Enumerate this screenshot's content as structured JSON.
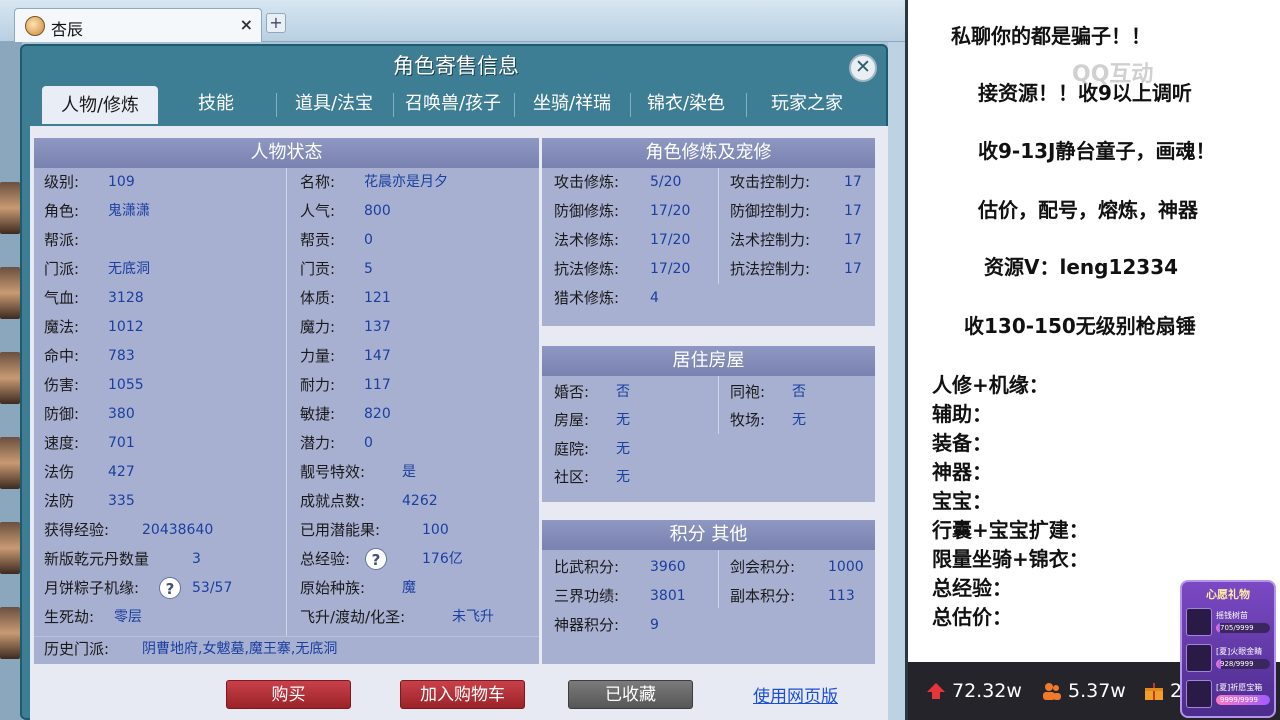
{
  "browser": {
    "tab_title": "杏辰",
    "tab_close": "×",
    "new_tab": "+"
  },
  "dialog": {
    "title": "角色寄售信息",
    "close": "✕",
    "tabs": [
      "人物/修炼",
      "技能",
      "道具/法宝",
      "召唤兽/孩子",
      "坐骑/祥瑞",
      "锦衣/染色",
      "玩家之家"
    ]
  },
  "status": {
    "header": "人物状态",
    "rows": [
      [
        "级别:",
        "109",
        "名称:",
        "花晨亦是月夕"
      ],
      [
        "角色:",
        "鬼潇潇",
        "人气:",
        "800"
      ],
      [
        "帮派:",
        "",
        "帮贡:",
        "0"
      ],
      [
        "门派:",
        "无底洞",
        "门贡:",
        "5"
      ],
      [
        "气血:",
        "3128",
        "体质:",
        "121"
      ],
      [
        "魔法:",
        "1012",
        "魔力:",
        "137"
      ],
      [
        "命中:",
        "783",
        "力量:",
        "147"
      ],
      [
        "伤害:",
        "1055",
        "耐力:",
        "117"
      ],
      [
        "防御:",
        "380",
        "敏捷:",
        "820"
      ],
      [
        "速度:",
        "701",
        "潜力:",
        "0"
      ],
      [
        "法伤",
        "427",
        "靓号特效:",
        "是"
      ],
      [
        "法防",
        "335",
        "成就点数:",
        "4262"
      ],
      [
        "获得经验:",
        "20438640",
        "已用潜能果:",
        "100"
      ],
      [
        "新版乾元丹数量",
        "3",
        "总经验:",
        "176亿"
      ],
      [
        "月饼粽子机缘:",
        "53/57",
        "原始种族:",
        "魔"
      ],
      [
        "生死劫:",
        "零层",
        "飞升/渡劫/化圣:",
        "未飞升"
      ]
    ],
    "history_label": "历史门派:",
    "history_value": "阴曹地府,女魃墓,魔王寨,无底洞",
    "qmark": "?"
  },
  "cultivation": {
    "header": "角色修炼及宠修",
    "rows": [
      [
        "攻击修炼:",
        "5/20",
        "攻击控制力:",
        "17"
      ],
      [
        "防御修炼:",
        "17/20",
        "防御控制力:",
        "17"
      ],
      [
        "法术修炼:",
        "17/20",
        "法术控制力:",
        "17"
      ],
      [
        "抗法修炼:",
        "17/20",
        "抗法控制力:",
        "17"
      ],
      [
        "猎术修炼:",
        "4",
        "",
        ""
      ]
    ]
  },
  "housing": {
    "header": "居住房屋",
    "rows": [
      [
        "婚否:",
        "否",
        "同袍:",
        "否"
      ],
      [
        "房屋:",
        "无",
        "牧场:",
        "无"
      ],
      [
        "庭院:",
        "无",
        "",
        ""
      ],
      [
        "社区:",
        "无",
        "",
        ""
      ]
    ]
  },
  "points": {
    "header": "积分 其他",
    "rows": [
      [
        "比武积分:",
        "3960",
        "剑会积分:",
        "1000"
      ],
      [
        "三界功绩:",
        "3801",
        "副本积分:",
        "113"
      ],
      [
        "神器积分:",
        "9",
        "",
        ""
      ]
    ]
  },
  "buttons": {
    "buy": "购买",
    "cart": "加入购物车",
    "favorited": "已收藏",
    "web": "使用网页版"
  },
  "promo": {
    "lines": [
      "私聊你的都是骗子！！",
      "接资源！！收9以上调听",
      "收9-13J静台童子，画魂！",
      "估价，配号，熔炼，神器",
      "资源V：leng12334",
      "收130-150无级别枪扇锤"
    ],
    "list": [
      "人修+机缘：",
      "辅助：",
      "装备：",
      "神器：",
      "宝宝：",
      "行囊+宝宝扩建：",
      "限量坐骑+锦衣：",
      "总经验：",
      "总估价："
    ],
    "watermark": "QQ互动"
  },
  "stats": {
    "popularity": "72.32w",
    "followers": "5.37w",
    "gifts_partial": "2"
  },
  "gift_panel": {
    "title": "心愿礼物",
    "items": [
      {
        "name": "摇钱树苗",
        "count": "705/9999",
        "progress": 0.07
      },
      {
        "name": "[夏]火眼金睛",
        "count": "928/9999",
        "progress": 0.09
      },
      {
        "name": "[夏]祈愿宝箱",
        "count": "9999/9999",
        "progress": 1.0
      }
    ]
  },
  "colors": {
    "dialog_bg": "#3e7e94",
    "panel_header": "#7982b0",
    "value_text": "#1a3fa0",
    "buy_button": "#b22f36",
    "favorited_button": "#666666",
    "link": "#1a4fd6"
  }
}
